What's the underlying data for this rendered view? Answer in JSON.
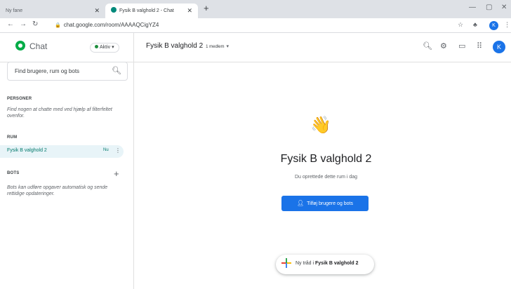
{
  "browser": {
    "tabs": [
      {
        "title": "Ny fane"
      },
      {
        "title": "Fysik B valghold 2 - Chat"
      }
    ],
    "url": "chat.google.com/room/AAAAQCigYZ4",
    "profile_initial": "K"
  },
  "app": {
    "name": "Chat",
    "status": "Aktiv"
  },
  "sidebar": {
    "search_placeholder": "Find brugere, rum og bots",
    "people_title": "PERSONER",
    "people_hint": "Find nogen at chatte med ved hjælp af filterfeltet ovenfor.",
    "rooms_title": "RUM",
    "rooms": [
      {
        "name": "Fysik B valghold 2",
        "badge": "Nu"
      }
    ],
    "bots_title": "BOTS",
    "bots_hint": "Bots kan udføre opgaver automatisk og sende rettidige opdateringer."
  },
  "room": {
    "title": "Fysik B valghold 2",
    "members": "1 medlem",
    "header_avatar": "K"
  },
  "main": {
    "emoji": "👋",
    "title": "Fysik B valghold 2",
    "subtitle": "Du oprettede dette rum i dag",
    "add_button": "Tilføj brugere og bots",
    "new_thread_prefix": "Ny tråd i",
    "new_thread_room": "Fysik B valghold 2"
  },
  "colors": {
    "accent": "#1a73e8",
    "room_highlight": "#e8f4f8",
    "room_text": "#00796b",
    "status_green": "#1e8e3e"
  }
}
